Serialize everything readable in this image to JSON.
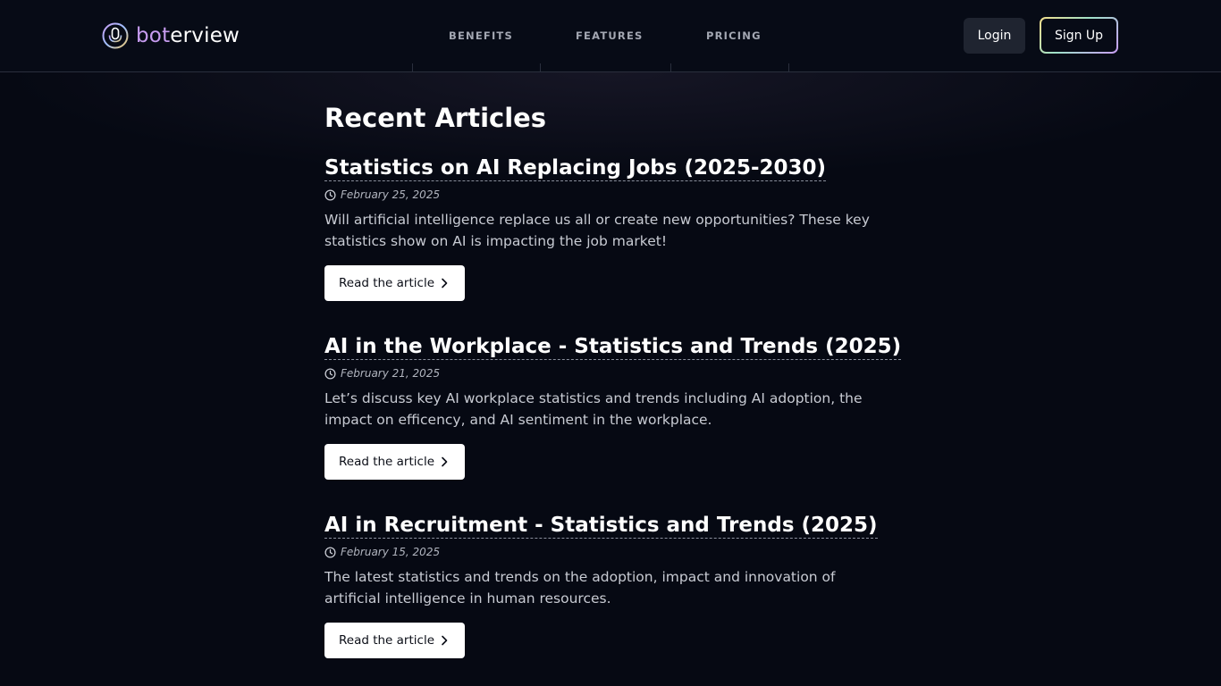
{
  "brand": {
    "logo_text_part1": "bot",
    "logo_text_part2": "erview",
    "logo_icon": "microphone-icon"
  },
  "nav": {
    "items": [
      {
        "label": "BENEFITS"
      },
      {
        "label": "FEATURES"
      },
      {
        "label": "PRICING"
      }
    ]
  },
  "auth": {
    "login_label": "Login",
    "signup_label": "Sign Up"
  },
  "main": {
    "title": "Recent Articles",
    "articles": [
      {
        "title": "Statistics on AI Replacing Jobs (2025-2030)",
        "date": "February 25, 2025",
        "description": "Will artificial intelligence replace us all or create new opportunities? These key statistics show on AI is impacting the job market!",
        "button_label": "Read the article"
      },
      {
        "title": "AI in the Workplace - Statistics and Trends (2025)",
        "date": "February 21, 2025",
        "description": "Let’s discuss key AI workplace statistics and trends including AI adoption, the impact on efficency, and AI sentiment in the workplace.",
        "button_label": "Read the article"
      },
      {
        "title": "AI in Recruitment - Statistics and Trends (2025)",
        "date": "February 15, 2025",
        "description": "The latest statistics and trends on the adoption, impact and innovation of artificial intelligence in human resources.",
        "button_label": "Read the article"
      }
    ]
  },
  "colors": {
    "background": "#060913",
    "header_border": "#2a2f3d",
    "login_bg": "#1f2430",
    "signup_gradient_start": "#f3dd8a",
    "signup_gradient_end": "#c89cf3",
    "button_bg": "#ffffff"
  }
}
